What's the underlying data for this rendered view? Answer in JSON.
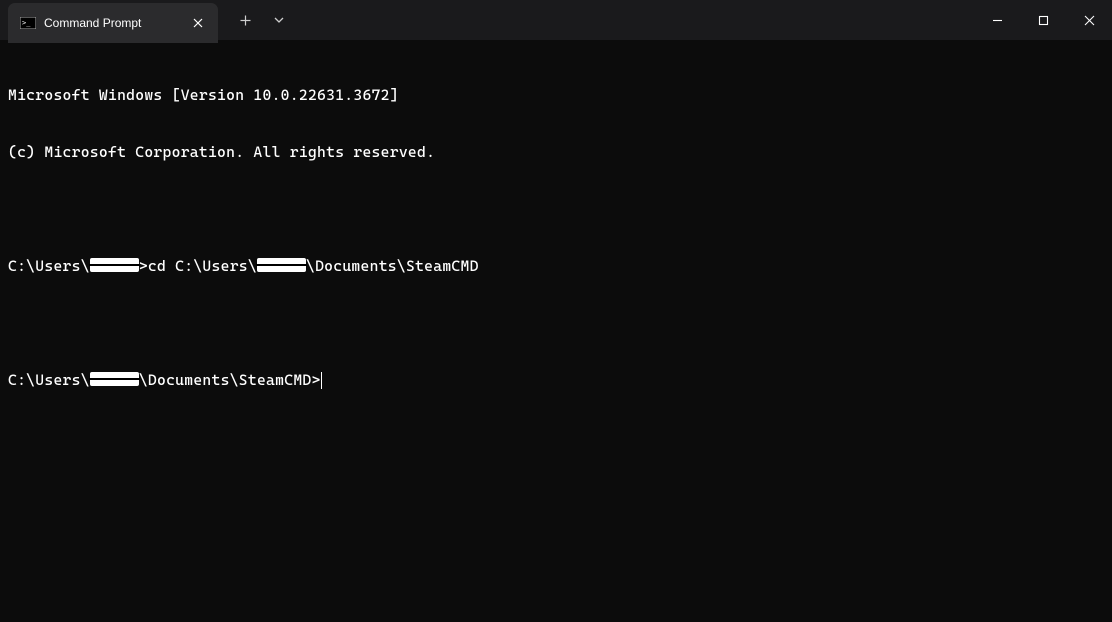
{
  "titlebar": {
    "tab": {
      "title": "Command Prompt"
    }
  },
  "terminal": {
    "header_line1": "Microsoft Windows [Version 10.0.22631.3672]",
    "header_line2": "(c) Microsoft Corporation. All rights reserved.",
    "line1_prefix": "C:\\Users\\",
    "line1_after_redact": ">cd C:\\Users\\",
    "line1_tail": "\\Documents\\SteamCMD",
    "line2_prefix": "C:\\Users\\",
    "line2_after_redact": "\\Documents\\SteamCMD>"
  }
}
